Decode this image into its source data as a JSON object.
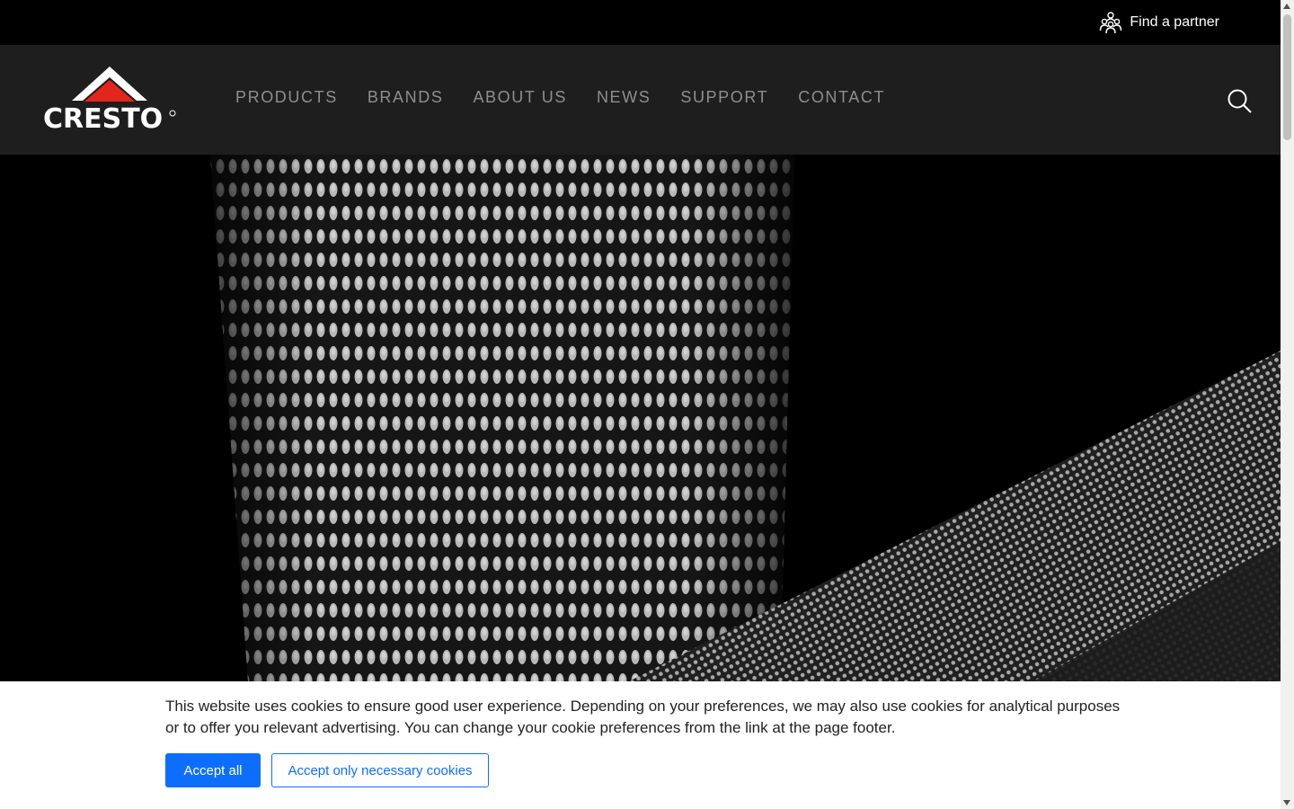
{
  "topbar": {
    "partner_label": "Find a partner",
    "partner_icon": "people-icon"
  },
  "header": {
    "logo_text": "CRESTO",
    "nav": [
      {
        "label": "PRODUCTS"
      },
      {
        "label": "BRANDS"
      },
      {
        "label": "ABOUT US"
      },
      {
        "label": "NEWS"
      },
      {
        "label": "SUPPORT"
      },
      {
        "label": "CONTACT"
      }
    ],
    "search_icon": "search-icon"
  },
  "hero": {
    "image": "close-up-webbing-strap-photo"
  },
  "cookie": {
    "text": "This website uses cookies to ensure good user experience. Depending on your preferences, we may also use cookies for analytical purposes or to offer you relevant advertising. You can change your cookie preferences from the link at the page footer.",
    "accept_all": "Accept all",
    "accept_necessary": "Accept only necessary cookies"
  },
  "colors": {
    "topbar_bg": "#000000",
    "navbar_bg": "#1e1e1e",
    "nav_text": "#8e8e8e",
    "logo_red": "#e3261b",
    "primary_button": "#0d6efd"
  }
}
